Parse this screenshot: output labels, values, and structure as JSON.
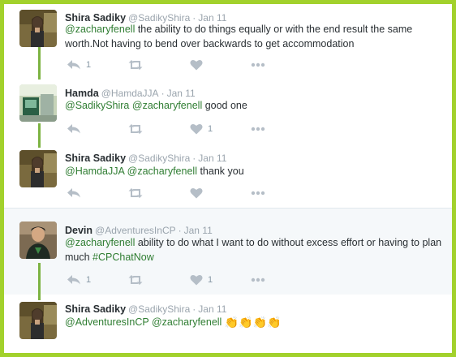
{
  "tweets": [
    {
      "name": "Shira Sadiky",
      "handle": "@SadikyShira",
      "date": "Jan 11",
      "text_parts": [
        {
          "t": "@zacharyfenell",
          "k": "mention"
        },
        {
          "t": " the ability to do things equally or with the end result the same worth.Not having to bend over backwards to get accommodation",
          "k": "text"
        }
      ],
      "reply_count": "1",
      "like_count": ""
    },
    {
      "name": "Hamda",
      "handle": "@HamdaJJA",
      "date": "Jan 11",
      "text_parts": [
        {
          "t": "@SadikyShira",
          "k": "mention"
        },
        {
          "t": " ",
          "k": "text"
        },
        {
          "t": "@zacharyfenell",
          "k": "mention"
        },
        {
          "t": " good one",
          "k": "text"
        }
      ],
      "reply_count": "",
      "like_count": "1"
    },
    {
      "name": "Shira Sadiky",
      "handle": "@SadikyShira",
      "date": "Jan 11",
      "text_parts": [
        {
          "t": "@HamdaJJA",
          "k": "mention"
        },
        {
          "t": " ",
          "k": "text"
        },
        {
          "t": "@zacharyfenell",
          "k": "mention"
        },
        {
          "t": " thank you",
          "k": "text"
        }
      ],
      "reply_count": "",
      "like_count": ""
    },
    {
      "name": "Devin",
      "handle": "@AdventuresInCP",
      "date": "Jan 11",
      "text_parts": [
        {
          "t": "@zacharyfenell",
          "k": "mention"
        },
        {
          "t": " ability to do what I want to do without excess effort or having to plan much ",
          "k": "text"
        },
        {
          "t": "#CPChatNow",
          "k": "hashtag"
        }
      ],
      "reply_count": "1",
      "like_count": "1"
    },
    {
      "name": "Shira Sadiky",
      "handle": "@SadikyShira",
      "date": "Jan 11",
      "text_parts": [
        {
          "t": "@AdventuresInCP",
          "k": "mention"
        },
        {
          "t": " ",
          "k": "text"
        },
        {
          "t": "@zacharyfenell",
          "k": "mention"
        },
        {
          "t": " ",
          "k": "text"
        },
        {
          "t": "👏👏👏👏",
          "k": "emoji"
        }
      ],
      "reply_count": "",
      "like_count": ""
    }
  ],
  "date_separator": "·",
  "icons": {
    "reply": "reply-icon",
    "retweet": "retweet-icon",
    "like": "heart-icon",
    "more": "more-icon"
  },
  "colors": {
    "border": "#a2d12c",
    "link": "#2f7d32",
    "thread_line": "#7cb342",
    "highlight_bg": "#f5f8fa"
  }
}
